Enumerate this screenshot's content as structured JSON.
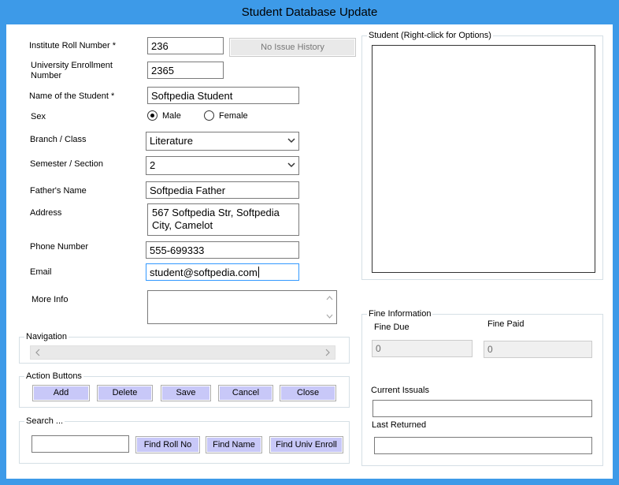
{
  "window": {
    "title": "Student Database Update"
  },
  "form": {
    "roll_label": "Institute Roll  Number *",
    "roll_value": "236",
    "issue_history_button": "No Issue History",
    "enroll_label": "University Enrollment Number",
    "enroll_value": "2365",
    "name_label": "Name of the Student *",
    "name_value": "Softpedia Student",
    "sex_label": "Sex",
    "sex_male": "Male",
    "sex_female": "Female",
    "sex_selected": "Male",
    "branch_label": "Branch / Class",
    "branch_value": "Literature",
    "semester_label": "Semester / Section",
    "semester_value": "2",
    "father_label": "Father's Name",
    "father_value": "Softpedia Father",
    "address_label": "Address",
    "address_value": "567 Softpedia Str, Softpedia City, Camelot",
    "phone_label": "Phone Number",
    "phone_value": "555-699333",
    "email_label": "Email",
    "email_value": "student@softpedia.com",
    "more_info_label": "More Info",
    "more_info_value": ""
  },
  "student_panel": {
    "caption": "Student (Right-click for Options)"
  },
  "navigation": {
    "caption": "Navigation"
  },
  "actions": {
    "caption": "Action Buttons",
    "add": "Add",
    "delete": "Delete",
    "save": "Save",
    "cancel": "Cancel",
    "close": "Close"
  },
  "search": {
    "caption": "Search ...",
    "input_value": "",
    "find_roll": "Find Roll No",
    "find_name": "Find Name",
    "find_univ": "Find Univ Enroll"
  },
  "fine": {
    "caption": "Fine Information",
    "due_label": "Fine Due",
    "due_value": "0",
    "paid_label": "Fine Paid",
    "paid_value": "0",
    "current_issuals_label": "Current Issuals",
    "current_issuals_value": "",
    "last_returned_label": "Last Returned",
    "last_returned_value": ""
  }
}
